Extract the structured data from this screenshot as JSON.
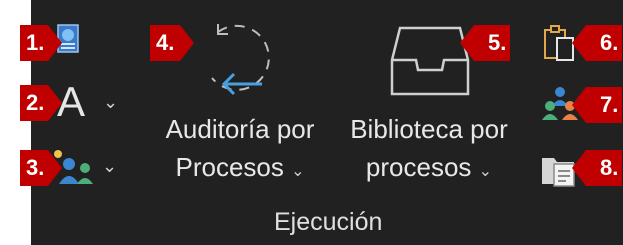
{
  "callouts": {
    "c1": "1.",
    "c2": "2.",
    "c3": "3.",
    "c4": "4.",
    "c5": "5.",
    "c6": "6.",
    "c7": "7.",
    "c8": "8."
  },
  "buttons": {
    "auditoria_line1": "Auditoría por",
    "auditoria_line2": "Procesos",
    "biblioteca_line1": "Biblioteca por",
    "biblioteca_line2": "procesos",
    "font_glyph": "A"
  },
  "group": {
    "label": "Ejecución"
  },
  "icons": {
    "i1": "report-document-icon",
    "i2": "font-letter-icon",
    "i3": "users-settings-icon",
    "i4": "refresh-arrow-icon",
    "i5": "inbox-tray-icon",
    "i6": "clipboard-copy-icon",
    "i7": "users-group-icon",
    "i8": "document-folder-icon"
  },
  "colors": {
    "ribbon_bg": "#212121",
    "callout": "#c00000",
    "accent_blue": "#4a9fe0"
  }
}
